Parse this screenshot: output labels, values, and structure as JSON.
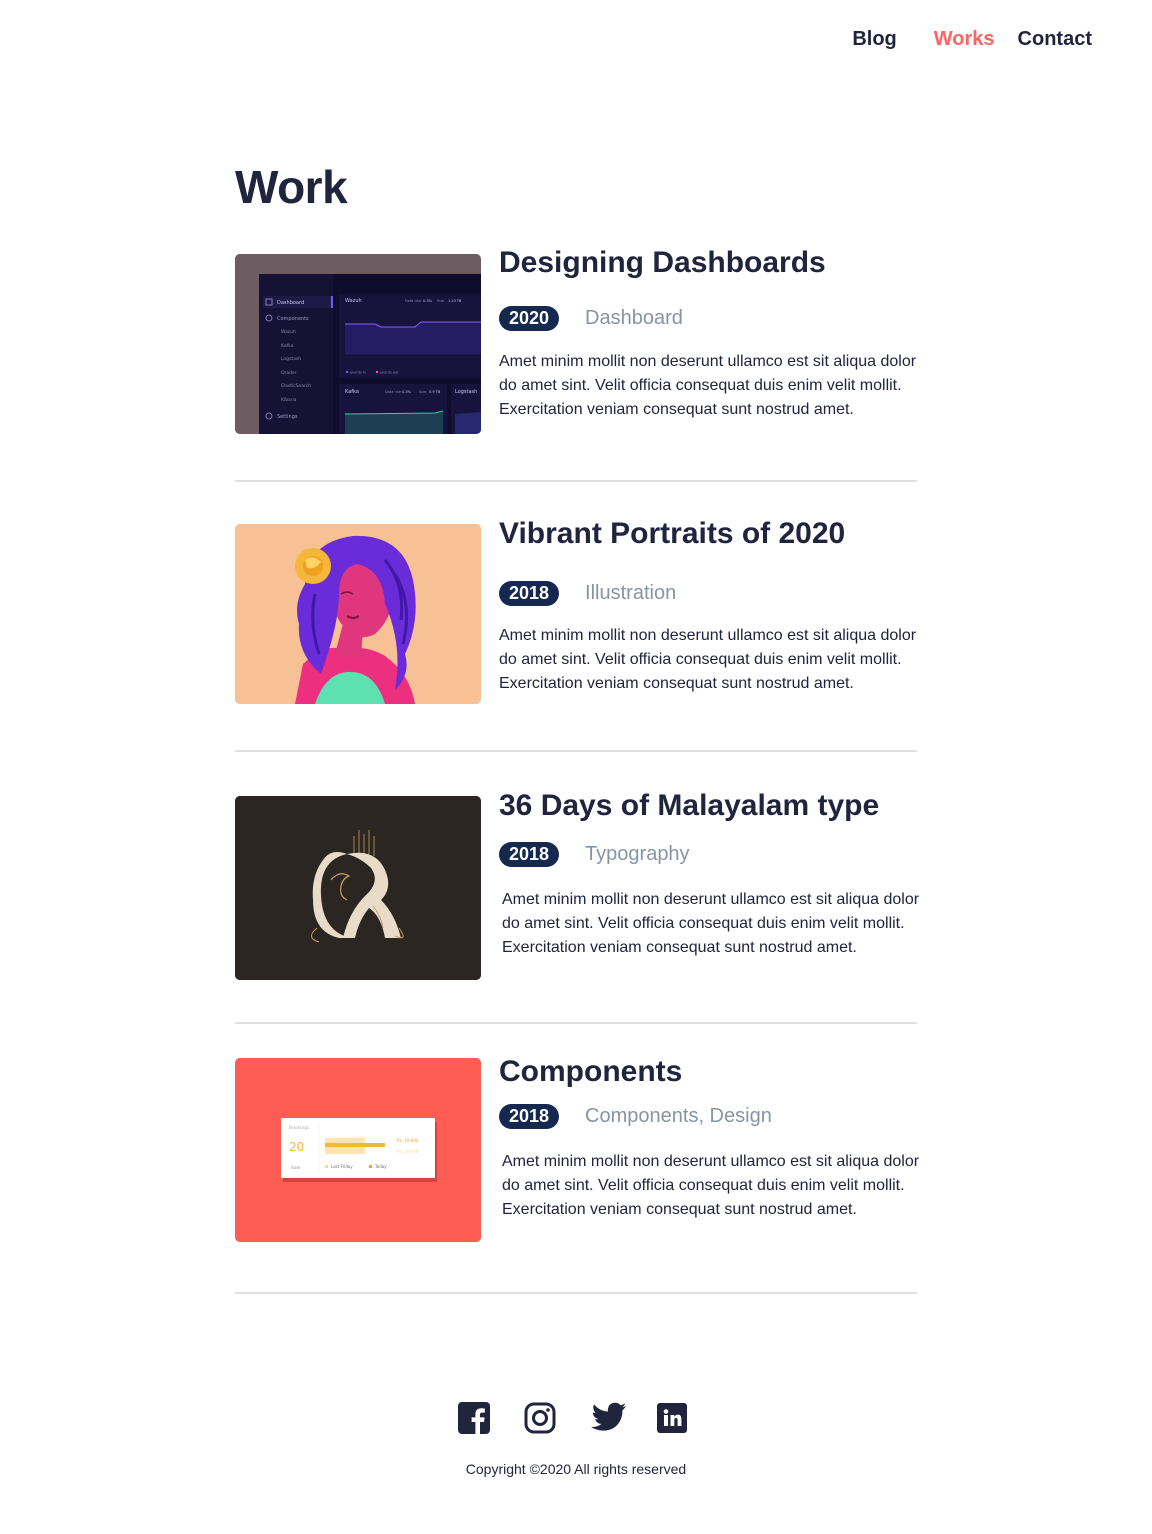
{
  "nav": {
    "blog": "Blog",
    "works": "Works",
    "contact": "Contact",
    "active_color": "#ff6464"
  },
  "page_title": "Work",
  "works": [
    {
      "title": "Designing Dashboards",
      "year": "2020",
      "category": "Dashboard",
      "description": "Amet minim mollit non deserunt ullamco est sit aliqua dolor do amet sint. Velit officia consequat duis enim velit mollit. Exercitation veniam consequat sunt nostrud amet.",
      "thumb": {
        "sidebar": [
          "Dashboard",
          "Components",
          "Wazuh",
          "Kafka",
          "Logstash",
          "Qrader",
          "ElasticSearch",
          "Kibana",
          "Settings"
        ],
        "panel_a": "Wazuh",
        "panel_b": "Kafka",
        "panel_c": "Logstash",
        "stat_labels": [
          "Data rise",
          "0.3%",
          "Size",
          "1.23 TB"
        ],
        "stat_labels_b": [
          "Data rise",
          "0.3%",
          "Size",
          "0.9 TB"
        ],
        "legend": [
          "events in",
          "events out"
        ]
      }
    },
    {
      "title": "Vibrant Portraits of 2020",
      "year": "2018",
      "category": "Illustration",
      "description": "Amet minim mollit non deserunt ullamco est sit aliqua dolor do amet sint. Velit officia consequat duis enim velit mollit. Exercitation veniam consequat sunt nostrud amet."
    },
    {
      "title": "36 Days of Malayalam type",
      "year": "2018",
      "category": "Typography",
      "description": "Amet minim mollit non deserunt ullamco est sit aliqua dolor do amet sint. Velit officia consequat duis enim velit mollit. Exercitation veniam consequat sunt nostrud amet."
    },
    {
      "title": "Components",
      "year": "2018",
      "category": "Components, Design",
      "description": "Amet minim mollit non deserunt ullamco est sit aliqua dolor do amet sint. Velit officia consequat duis enim velit mollit. Exercitation veniam consequat sunt nostrud amet.",
      "thumb": {
        "card_label": "Bookings",
        "card_value": "20",
        "card_sub": "Sale",
        "price_a": "Rs. 19,800",
        "price_b": "Rs. 19,970",
        "legend_a": "Last Friday",
        "legend_b": "Today"
      }
    }
  ],
  "social": [
    "facebook-icon",
    "instagram-icon",
    "twitter-icon",
    "linkedin-icon"
  ],
  "footer": {
    "copyright": "Copyright ©2020 All rights reserved"
  },
  "colors": {
    "text": "#21243d",
    "badge": "#142850",
    "muted": "#8695a4",
    "accent": "#ff6464"
  }
}
